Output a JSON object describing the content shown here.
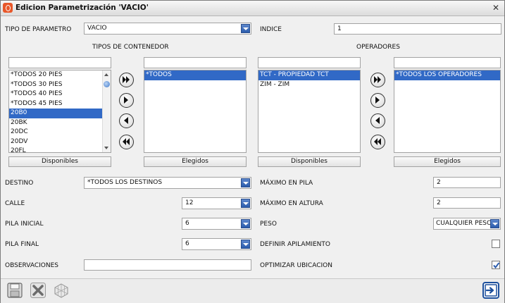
{
  "window": {
    "title": "Edicion Parametrización  'VACIO'",
    "close_symbol": "✕"
  },
  "parametro": {
    "label": "TIPO DE PARAMETRO",
    "value": "VACIO"
  },
  "indice": {
    "label": "INDICE",
    "value": "1"
  },
  "contenedor": {
    "heading": "TIPOS DE CONTENEDOR",
    "available_filter": "",
    "available": [
      "*TODOS 20 PIES",
      "*TODOS 30 PIES",
      "*TODOS 40 PIES",
      "*TODOS 45 PIES",
      "20B0",
      "20BK",
      "20DC",
      "20DV",
      "20FL"
    ],
    "available_selected": "20B0",
    "chosen_filter": "",
    "chosen": [
      "*TODOS"
    ],
    "available_button": "Disponibles",
    "chosen_button": "Elegidos"
  },
  "operadores": {
    "heading": "OPERADORES",
    "available_filter": "",
    "available": [
      "TCT - PROPIEDAD TCT",
      "ZIM - ZIM"
    ],
    "available_selected": "TCT - PROPIEDAD TCT",
    "chosen_filter": "",
    "chosen": [
      "*TODOS LOS OPERADORES"
    ],
    "available_button": "Disponibles",
    "chosen_button": "Elegidos"
  },
  "destino": {
    "label": "DESTINO",
    "value": "*TODOS LOS DESTINOS"
  },
  "calle": {
    "label": "CALLE",
    "value": "12"
  },
  "pila_inicial": {
    "label": "PILA INICIAL",
    "value": "6"
  },
  "pila_final": {
    "label": "PILA FINAL",
    "value": "6"
  },
  "observaciones": {
    "label": "OBSERVACIONES",
    "value": ""
  },
  "maximo_pila": {
    "label": "MÁXIMO EN PILA",
    "value": "2"
  },
  "maximo_altura": {
    "label": "MÁXIMO EN ALTURA",
    "value": "2"
  },
  "peso": {
    "label": "PESO",
    "value": "CUALQUIER PESO"
  },
  "definir_apilamiento": {
    "label": "DEFINIR APILAMIENTO",
    "checked": false
  },
  "optimizar_ubicacion": {
    "label": "OPTIMIZAR UBICACION",
    "checked": true
  },
  "colors": {
    "selection": "#3169c6",
    "dropdown": "#2b5cad",
    "exit_button": "#1c4f9c"
  },
  "icons": [
    "save-icon",
    "delete-icon",
    "grid-icon",
    "exit-icon"
  ]
}
